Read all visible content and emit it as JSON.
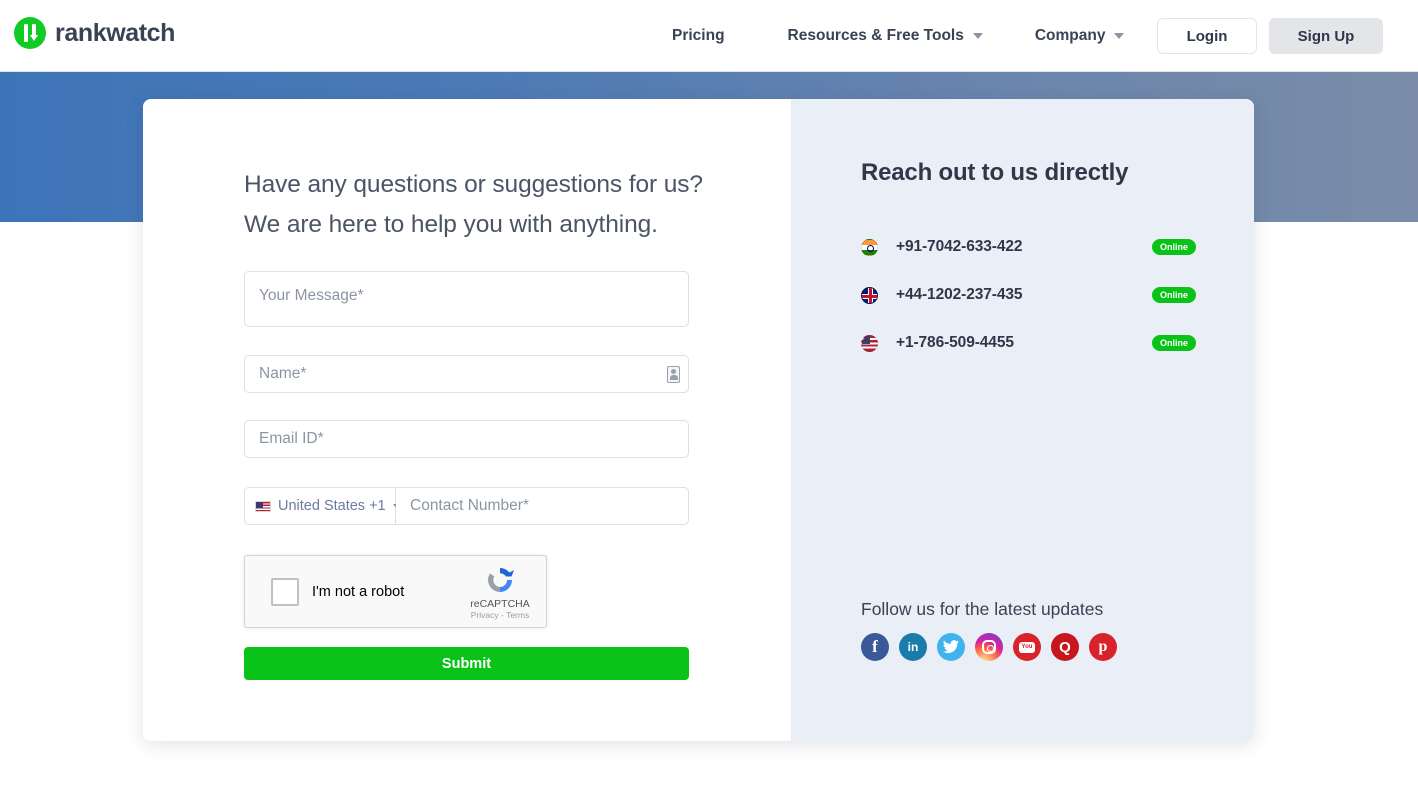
{
  "header": {
    "brand": "rankwatch",
    "nav": [
      {
        "label": "Pricing",
        "has_dropdown": false
      },
      {
        "label": "Resources & Free Tools",
        "has_dropdown": true
      },
      {
        "label": "Company",
        "has_dropdown": true
      }
    ],
    "login_label": "Login",
    "signup_label": "Sign Up"
  },
  "form": {
    "heading_line1": "Have any questions or suggestions for us?",
    "heading_line2": "We are here to help you with anything.",
    "message_placeholder": "Your Message*",
    "name_placeholder": "Name*",
    "email_placeholder": "Email ID*",
    "country_label": "United States +1",
    "contact_placeholder": "Contact Number*",
    "submit_label": "Submit",
    "recaptcha": {
      "label": "I'm not a robot",
      "brand": "reCAPTCHA",
      "legal": "Privacy - Terms"
    }
  },
  "info": {
    "heading": "Reach out to us directly",
    "phones": [
      {
        "flag": "india-flag-icon",
        "number": "+91-7042-633-422",
        "status": "Online"
      },
      {
        "flag": "uk-flag-icon",
        "number": "+44-1202-237-435",
        "status": "Online"
      },
      {
        "flag": "usa-flag-icon",
        "number": "+1-786-509-4455",
        "status": "Online"
      }
    ],
    "follow_heading": "Follow us for the latest updates",
    "social": [
      {
        "name": "facebook",
        "glyph": "f"
      },
      {
        "name": "linkedin",
        "glyph": "in"
      },
      {
        "name": "twitter",
        "glyph": "ᴠ"
      },
      {
        "name": "instagram",
        "glyph": ""
      },
      {
        "name": "youtube",
        "glyph": "You"
      },
      {
        "name": "quora",
        "glyph": "Q"
      },
      {
        "name": "pinterest",
        "glyph": "р"
      }
    ]
  },
  "colors": {
    "brand_green": "#0ac318",
    "banner_start": "#3d74b8",
    "banner_end": "#7a8ca8",
    "info_panel": "#eaeef6",
    "text_dark": "#2f3749"
  }
}
